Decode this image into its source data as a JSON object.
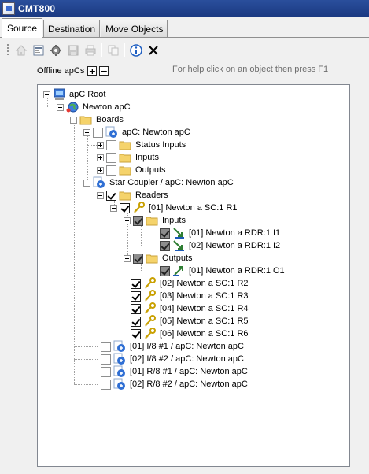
{
  "window": {
    "title": "CMT800"
  },
  "tabs": [
    {
      "label": "Source",
      "active": true
    },
    {
      "label": "Destination",
      "active": false
    },
    {
      "label": "Move Objects",
      "active": false
    }
  ],
  "toolbar": {
    "buttons": [
      "home-icon",
      "properties-icon",
      "settings-gear-icon",
      "save-icon",
      "print-icon",
      "copy-icon",
      "info-icon",
      "close-x-icon"
    ]
  },
  "offline": {
    "label": "Offline apCs",
    "expand": "+",
    "collapse": "−"
  },
  "help_text": "For help click on an object then press F1",
  "tree": {
    "nodes": [
      {
        "label": "apC Root",
        "icon": "computer-icon"
      },
      {
        "label": "Newton apC",
        "icon": "globe-network-icon"
      },
      {
        "label": "Boards",
        "icon": "folder-icon"
      },
      {
        "label": "apC: Newton apC",
        "icon": "board-icon"
      },
      {
        "label": "Status Inputs",
        "icon": "folder-icon"
      },
      {
        "label": "Inputs",
        "icon": "folder-icon"
      },
      {
        "label": "Outputs",
        "icon": "folder-icon"
      },
      {
        "label": "Star Coupler / apC: Newton apC",
        "icon": "board-icon"
      },
      {
        "label": "Readers",
        "icon": "folder-icon"
      },
      {
        "label": "[01] Newton a SC:1 R1",
        "icon": "key-icon"
      },
      {
        "label": "Inputs",
        "icon": "folder-icon"
      },
      {
        "label": "[01] Newton a RDR:1 I1",
        "icon": "input-arrow-icon"
      },
      {
        "label": "[02] Newton a RDR:1 I2",
        "icon": "input-arrow-icon"
      },
      {
        "label": "Outputs",
        "icon": "folder-icon"
      },
      {
        "label": "[01] Newton a RDR:1 O1",
        "icon": "output-arrow-icon"
      },
      {
        "label": "[02] Newton a SC:1 R2",
        "icon": "key-icon"
      },
      {
        "label": "[03] Newton a SC:1 R3",
        "icon": "key-icon"
      },
      {
        "label": "[04] Newton a SC:1 R4",
        "icon": "key-icon"
      },
      {
        "label": "[05] Newton a SC:1 R5",
        "icon": "key-icon"
      },
      {
        "label": "[06] Newton a SC:1 R6",
        "icon": "key-icon"
      },
      {
        "label": "[01] I/8 #1 / apC: Newton apC",
        "icon": "board-icon"
      },
      {
        "label": "[02] I/8 #2 / apC: Newton apC",
        "icon": "board-icon"
      },
      {
        "label": "[01] R/8 #1 / apC: Newton apC",
        "icon": "board-icon"
      },
      {
        "label": "[02] R/8 #2 / apC: Newton apC",
        "icon": "board-icon"
      }
    ]
  },
  "colors": {
    "titlebar": "#1b3a82",
    "folder": "#f5d36b",
    "selection": "#3399ff"
  }
}
